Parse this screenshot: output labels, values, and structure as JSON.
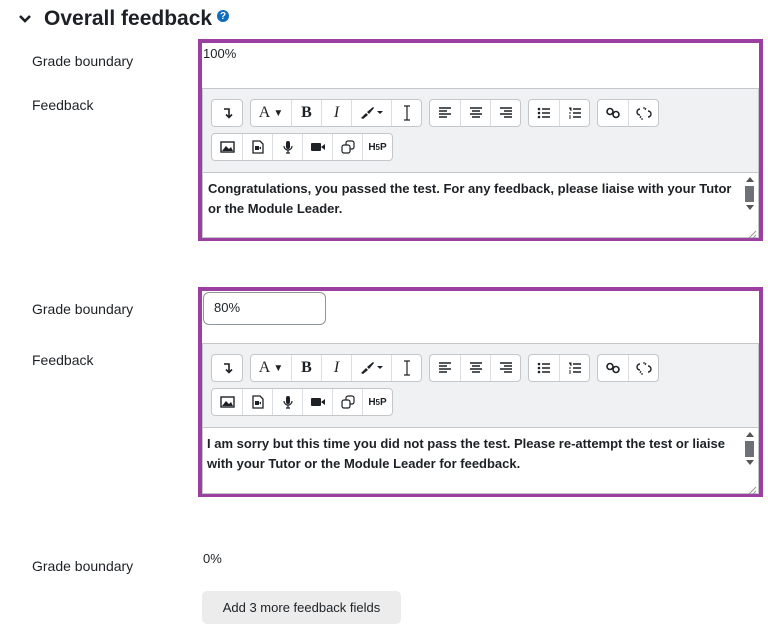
{
  "section": {
    "title": "Overall feedback",
    "help_icon": "help-question-icon",
    "collapse_icon": "chevron-down-icon"
  },
  "labels": {
    "grade_boundary": "Grade boundary",
    "feedback": "Feedback"
  },
  "toolbar": {
    "row1": [
      {
        "icon": "collapse-toolbar-icon",
        "glyph": "↴"
      },
      {
        "icon": "font-size-icon",
        "glyph": "A▾"
      },
      {
        "icon": "bold-icon",
        "glyph": "B"
      },
      {
        "icon": "italic-icon",
        "glyph": "I"
      },
      {
        "icon": "text-color-icon",
        "glyph": "✎▾"
      },
      {
        "icon": "clear-formatting-icon",
        "glyph": "I̲"
      },
      {
        "icon": "align-left-icon"
      },
      {
        "icon": "align-center-icon"
      },
      {
        "icon": "align-right-icon"
      },
      {
        "icon": "unordered-list-icon"
      },
      {
        "icon": "ordered-list-icon"
      },
      {
        "icon": "link-icon"
      },
      {
        "icon": "unlink-icon"
      }
    ],
    "row2": [
      {
        "icon": "image-icon"
      },
      {
        "icon": "media-icon"
      },
      {
        "icon": "record-audio-icon"
      },
      {
        "icon": "record-video-icon"
      },
      {
        "icon": "manage-files-icon"
      },
      {
        "icon": "h5p-icon",
        "glyph": "H5P"
      }
    ]
  },
  "feedback_blocks": [
    {
      "grade_boundary": "100%",
      "text": "Congratulations, you passed the test. For any feedback, please liaise with your Tutor or the Module Leader."
    },
    {
      "grade_boundary": "80%",
      "text": "I am sorry but this time you did not pass the test. Please re-attempt the test or liaise with your Tutor or the Module Leader for feedback."
    }
  ],
  "last_boundary": {
    "grade_boundary": "0%"
  },
  "add_button": "Add 3 more feedback fields",
  "colors": {
    "highlight": "#9b3fa0",
    "link": "#0f6cbf"
  }
}
